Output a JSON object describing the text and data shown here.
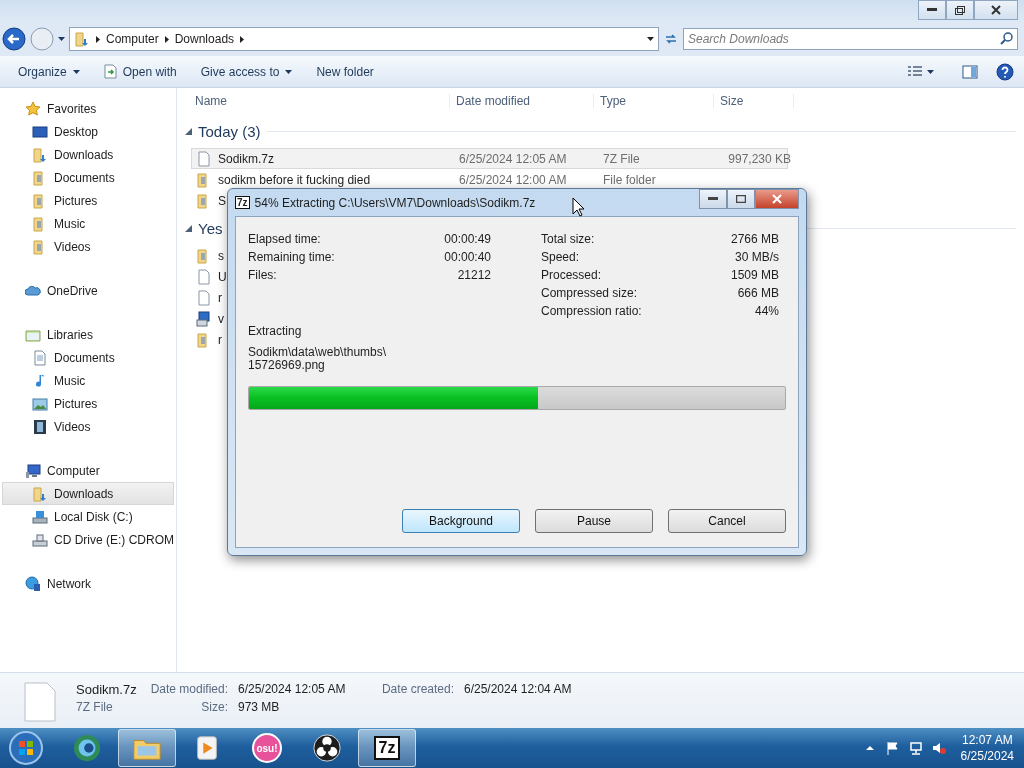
{
  "address_bar": {
    "path": [
      "Computer",
      "Downloads"
    ]
  },
  "search": {
    "placeholder": "Search Downloads"
  },
  "toolbar": [
    {
      "label": "Organize",
      "kind": "menu"
    },
    {
      "label": "Open with",
      "kind": "icon"
    },
    {
      "label": "Give access to",
      "kind": "menu"
    },
    {
      "label": "New folder",
      "kind": "plain"
    }
  ],
  "nav_pane": [
    {
      "label": "Favorites",
      "kind": "star",
      "selected": false,
      "children": [
        {
          "label": "Desktop",
          "kind": "desktop",
          "selected": false
        },
        {
          "label": "Downloads",
          "kind": "downloads",
          "selected": false
        },
        {
          "label": "Documents",
          "kind": "folder",
          "selected": false
        },
        {
          "label": "Pictures",
          "kind": "folder",
          "selected": false
        },
        {
          "label": "Music",
          "kind": "folder",
          "selected": false
        },
        {
          "label": "Videos",
          "kind": "folder",
          "selected": false
        }
      ]
    },
    {
      "label": "OneDrive",
      "kind": "cloud",
      "selected": false
    },
    {
      "label": "Libraries",
      "kind": "library",
      "selected": false,
      "children": [
        {
          "label": "Documents",
          "kind": "document",
          "selected": false
        },
        {
          "label": "Music",
          "kind": "music",
          "selected": false
        },
        {
          "label": "Pictures",
          "kind": "picture-lib",
          "selected": false
        },
        {
          "label": "Videos",
          "kind": "film",
          "selected": false
        }
      ]
    },
    {
      "label": "Computer",
      "kind": "computer",
      "selected": false,
      "children": [
        {
          "label": "Downloads",
          "kind": "downloads",
          "selected": true
        },
        {
          "label": "Local Disk (C:)",
          "kind": "disk",
          "selected": false
        },
        {
          "label": "CD Drive (E:) CDROM",
          "kind": "cdrom",
          "selected": false
        }
      ]
    },
    {
      "label": "Network",
      "kind": "network",
      "selected": false
    }
  ],
  "columns": [
    "Name",
    "Date modified",
    "Type",
    "Size"
  ],
  "groups": [
    {
      "label": "Today (3)",
      "expanded": true,
      "rows": [
        {
          "name": "Sodikm.7z",
          "date": "6/25/2024 12:05 AM",
          "type": "7Z File",
          "size": "997,230 KB",
          "kind": "file",
          "selected": true
        },
        {
          "name": "sodikm before it fucking died",
          "date": "6/25/2024 12:00 AM",
          "type": "File folder",
          "kind": "folder",
          "selected": false
        },
        {
          "name": "S",
          "kind": "folder",
          "selected": false
        }
      ]
    },
    {
      "label": "Yes",
      "expanded": true,
      "rows": [
        {
          "name": "s",
          "kind": "folder",
          "selected": false
        },
        {
          "name": "U",
          "kind": "file",
          "selected": false
        },
        {
          "name": "r",
          "kind": "file",
          "selected": false
        },
        {
          "name": "v",
          "kind": "setup",
          "selected": false
        },
        {
          "name": "r",
          "kind": "folder",
          "selected": false
        }
      ]
    }
  ],
  "dialog": {
    "icon_label": "7z",
    "title": "54% Extracting C:\\Users\\VM7\\Downloads\\Sodikm.7z",
    "stats_left": [
      {
        "label": "Elapsed time:",
        "value": "00:00:49"
      },
      {
        "label": "Remaining time:",
        "value": "00:00:40"
      },
      {
        "label": "Files:",
        "value": "21212"
      }
    ],
    "stats_right": [
      {
        "label": "Total size:",
        "value": "2766 MB"
      },
      {
        "label": "Speed:",
        "value": "30 MB/s"
      },
      {
        "label": "Processed:",
        "value": "1509 MB"
      },
      {
        "label": "Compressed size:",
        "value": "666 MB"
      },
      {
        "label": "Compression ratio:",
        "value": "44%"
      }
    ],
    "status": "Extracting",
    "current_file": [
      "Sodikm\\data\\web\\thumbs\\",
      "15726969.png"
    ],
    "progress": {
      "level": 0.54
    },
    "buttons": [
      {
        "label": "Background",
        "default": true
      },
      {
        "label": "Pause",
        "default": false
      },
      {
        "label": "Cancel",
        "default": false
      }
    ]
  },
  "details": {
    "name": "Sodikm.7z",
    "type": "7Z File",
    "fields": [
      {
        "label": "Date modified:",
        "value": "6/25/2024 12:05 AM"
      },
      {
        "label": "Date created:",
        "value": "6/25/2024 12:04 AM"
      },
      {
        "label": "Size:",
        "value": "973 MB"
      }
    ]
  },
  "taskbar": {
    "apps": [
      {
        "kind": "browser",
        "active": false
      },
      {
        "kind": "explorer",
        "active": true
      },
      {
        "kind": "media",
        "active": false
      },
      {
        "kind": "osu",
        "label": "osu!",
        "active": false
      },
      {
        "kind": "obs",
        "active": false
      },
      {
        "kind": "sevenzip",
        "label": "7z",
        "active": true
      }
    ],
    "clock": {
      "time": "12:07 AM",
      "date": "6/25/2024"
    }
  }
}
